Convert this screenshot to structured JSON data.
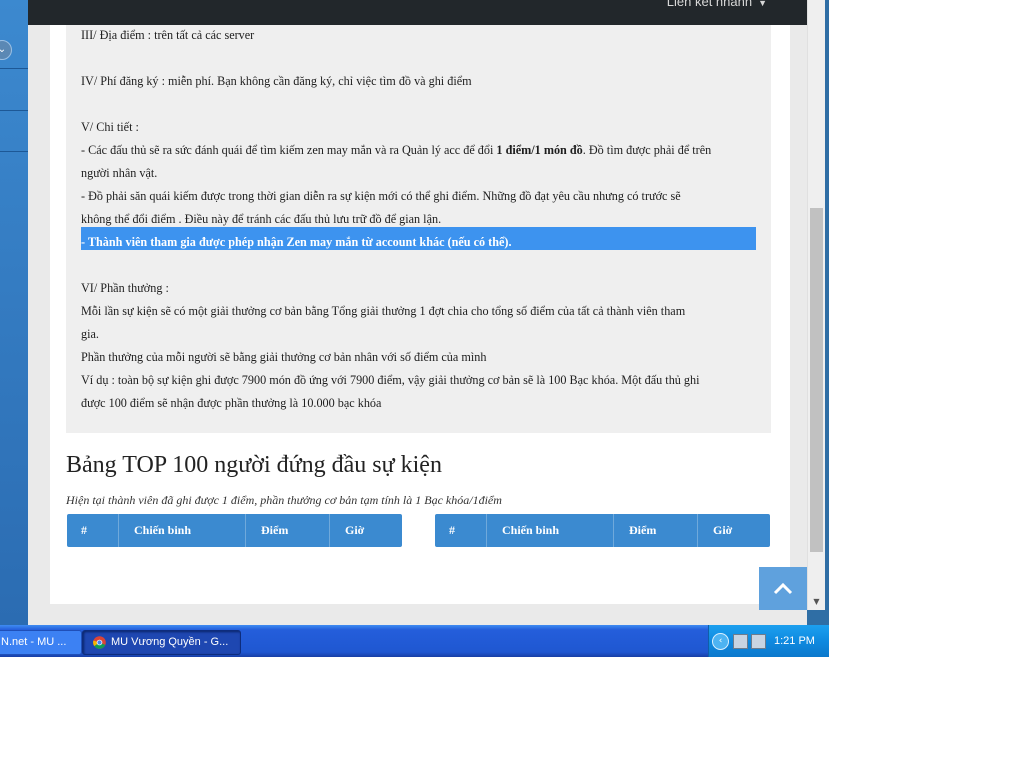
{
  "navbar": {
    "quick_links": "Liên kết nhanh"
  },
  "rules": {
    "location": "III/ Địa điểm : trên tất cả các server",
    "fee": "IV/ Phí đăng ký : miễn phí. Bạn không cần đăng ký, chỉ việc tìm đồ và ghi điểm",
    "details_heading": "V/ Chi tiết :",
    "details_1a": "- Các đấu thủ sẽ ra sức đánh quái để tìm kiếm zen may mắn và ra Quản lý acc để đổi ",
    "details_1b": "1 điểm/1 món đồ",
    "details_1c": ". Đồ tìm được phải để trên",
    "details_1d": "người nhân vật.",
    "details_2a": "- Đồ phải săn quái kiếm được trong thời gian diễn ra sự kiện mới có thể ghi điểm. Những đồ đạt yêu cầu nhưng có trước sẽ",
    "details_2b": "không thể đổi điểm . Điều này để tránh các đấu thủ lưu trữ đồ để gian lận.",
    "details_3": "- Thành viên tham gia được phép nhận Zen may mắn từ account khác (nếu có thể).",
    "reward_heading": "VI/ Phần thưởng :",
    "reward_1a": "Mỗi lần sự kiện sẽ có một giải thưởng cơ bản bằng Tổng giải thưởng 1 đợt chia cho tổng số điểm của tất cả thành viên tham",
    "reward_1b": "gia.",
    "reward_2": "Phần thưởng của mỗi người sẽ bằng giải thưởng cơ bản nhân với số điểm của mình",
    "reward_3a": "Ví dụ : toàn bộ sự kiện ghi được 7900 món đồ ứng với 7900 điểm, vậy giải thưởng cơ bản sẽ là 100 Bạc khóa. Một đấu thủ ghi",
    "reward_3b": "được 100 điểm sẽ nhận được phần thưởng là 10.000 bạc khóa"
  },
  "top": {
    "title": "Bảng TOP 100 người đứng đầu sự kiện",
    "subtitle": "Hiện tại thành viên đã ghi được 1 điểm, phần thưởng cơ bản tạm tính là 1 Bạc khóa/1điểm",
    "columns": [
      "#",
      "Chiến binh",
      "Điểm",
      "Giờ"
    ]
  },
  "taskbar": {
    "task1": "N.net - MU ...",
    "task2": "MU Vương Quyền - G...",
    "clock": "1:21 PM"
  },
  "colors": {
    "table_header": "#3b8ad0",
    "highlight": "#3d93ef",
    "navbar": "#22272b",
    "back_to_top": "#5fa1dd"
  },
  "icons": [
    "chevron-down-icon",
    "chevron-up-icon",
    "chrome-icon",
    "tray-expand-icon",
    "network-icon",
    "volume-icon"
  ]
}
